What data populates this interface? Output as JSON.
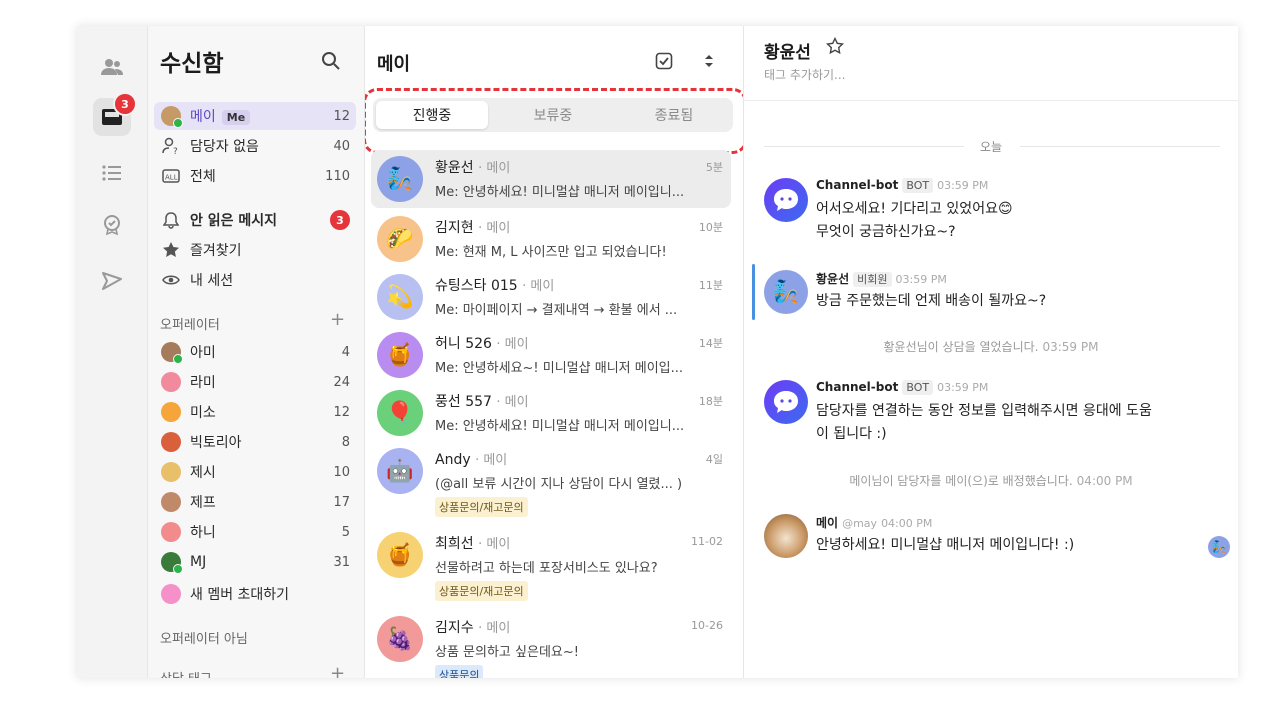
{
  "colors": {
    "accent_red": "#e5343a",
    "selected_purple": "#e7e3f7",
    "highlight_blue": "#4a90e2"
  },
  "rail": {
    "inbox_badge": "3"
  },
  "inbox": {
    "title": "수신함",
    "items": [
      {
        "label": "메이",
        "tag": "Me",
        "count": "12"
      },
      {
        "label": "담당자 없음",
        "count": "40"
      },
      {
        "label": "전체",
        "count": "110"
      },
      {
        "label": "안 읽은 메시지",
        "count": "3"
      },
      {
        "label": "즐겨찾기"
      },
      {
        "label": "내 세션"
      }
    ],
    "operators_header": "오퍼레이터",
    "operators": [
      {
        "name": "아미",
        "count": "4"
      },
      {
        "name": "라미",
        "count": "24"
      },
      {
        "name": "미소",
        "count": "12"
      },
      {
        "name": "빅토리아",
        "count": "8"
      },
      {
        "name": "제시",
        "count": "10"
      },
      {
        "name": "제프",
        "count": "17"
      },
      {
        "name": "하니",
        "count": "5"
      },
      {
        "name": "MJ",
        "count": "31"
      }
    ],
    "invite_label": "새 멤버 초대하기",
    "non_operators_header": "오퍼레이터 아님",
    "tags_header": "상담 태그"
  },
  "list": {
    "title": "메이",
    "tabs": [
      "진행중",
      "보류중",
      "종료됨"
    ],
    "chats": [
      {
        "name": "황윤선",
        "assignee": "· 메이",
        "time": "5분",
        "preview": "Me: 안녕하세요! 미니멀샵 매니저 메이입니...",
        "avatar": "🧞",
        "bg": "#8da2e6"
      },
      {
        "name": "김지현",
        "assignee": "· 메이",
        "time": "10분",
        "preview": "Me: 현재 M, L 사이즈만 입고 되었습니다!",
        "avatar": "🌮",
        "bg": "#f7c38a"
      },
      {
        "name": "슈팅스타 015",
        "assignee": "· 메이",
        "time": "11분",
        "preview": "Me: 마이페이지 → 결제내역 → 환불 에서 ...",
        "avatar": "💫",
        "bg": "#b7c0f0"
      },
      {
        "name": "허니 526",
        "assignee": "· 메이",
        "time": "14분",
        "preview": "Me: 안녕하세요~! 미니멀샵 매니저 메이입...",
        "avatar": "🍯",
        "bg": "#b98cf0"
      },
      {
        "name": "풍선 557",
        "assignee": "· 메이",
        "time": "18분",
        "preview": "Me: 안녕하세요! 미니멀샵 매니저 메이입니...",
        "avatar": "🎈",
        "bg": "#6bd07a"
      },
      {
        "name": "Andy",
        "assignee": "· 메이",
        "time": "4일",
        "preview": "(@all 보류 시간이 지나 상담이 다시 열렸...  )",
        "avatar": "🤖",
        "bg": "#a9b3f2",
        "tag": "상품문의/재고문의"
      },
      {
        "name": "최희선",
        "assignee": "· 메이",
        "time": "11-02",
        "preview": "선물하려고 하는데 포장서비스도 있나요?",
        "avatar": "🍯",
        "bg": "#f6d272",
        "tag": "상품문의/재고문의"
      },
      {
        "name": "김지수",
        "assignee": "· 메이",
        "time": "10-26",
        "preview": "상품 문의하고 싶은데요~!",
        "avatar": "🍇",
        "bg": "#f29a9a",
        "tag": "상품문의",
        "tag_color": "blue"
      }
    ]
  },
  "conversation": {
    "name": "황윤선",
    "tag_placeholder": "태그 추가하기...",
    "day_label": "오늘",
    "messages": [
      {
        "sender": "Channel-bot",
        "badge": "BOT",
        "time": "03:59 PM",
        "lines": [
          "어서오세요! 기다리고 있었어요😊",
          "무엇이 궁금하신가요~?"
        ]
      },
      {
        "sender": "황윤선",
        "badge": "비회원",
        "time": "03:59 PM",
        "lines": [
          "방금 주문했는데 언제 배송이 될까요~?"
        ]
      },
      {
        "system": "황윤선님이 상담을 열었습니다.",
        "time": "03:59 PM"
      },
      {
        "sender": "Channel-bot",
        "badge": "BOT",
        "time": "03:59 PM",
        "lines": [
          "담당자를 연결하는 동안 정보를 입력해주시면 응대에 도움",
          "이 됩니다 :)"
        ]
      },
      {
        "system": "메이님이 담당자를 메이(으)로 배정했습니다.",
        "time": "04:00 PM"
      },
      {
        "sender": "메이",
        "handle": "@may",
        "time": "04:00 PM",
        "lines": [
          "안녕하세요! 미니멀샵 매니저 메이입니다! :)"
        ]
      }
    ]
  }
}
